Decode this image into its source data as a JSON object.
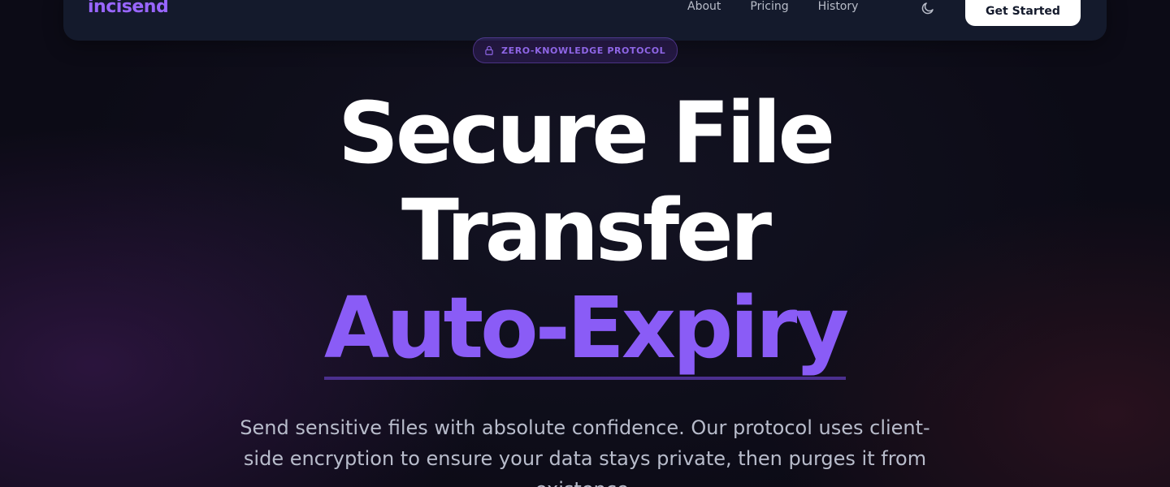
{
  "nav": {
    "brand": "incisend",
    "links": [
      "About",
      "Pricing",
      "History"
    ],
    "theme_toggle_icon": "moon-icon",
    "cta_label": "Get Started"
  },
  "badge": {
    "icon": "lock-icon",
    "text": "ZERO-KNOWLEDGE PROTOCOL"
  },
  "hero": {
    "line1": "Secure File",
    "line2": "Transfer",
    "accent": "Auto-Expiry",
    "subtitle": "Send sensitive files with absolute confidence. Our protocol uses client-side encryption to ensure your data stays private, then purges it from existence."
  },
  "colors": {
    "accent": "#8a5cf6",
    "navbar_bg": "#141a2c",
    "page_bg": "#0c0b16"
  }
}
